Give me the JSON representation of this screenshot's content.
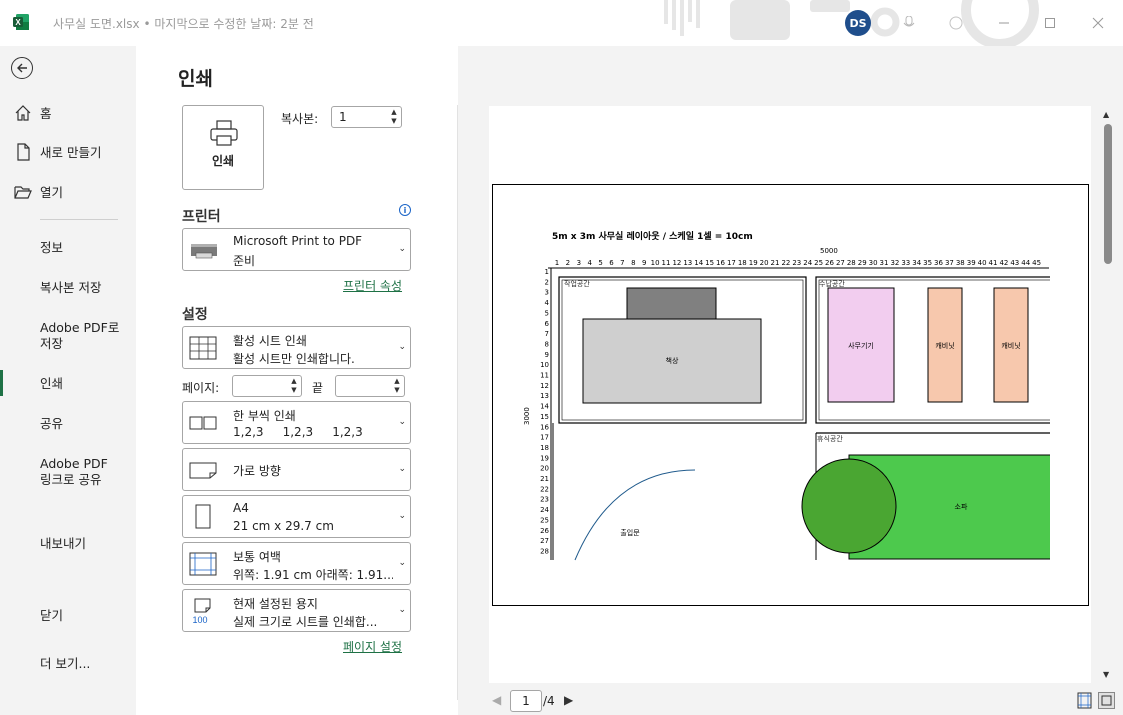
{
  "titlebar": {
    "file_name": "사무실 도면.xlsx",
    "separator": "•",
    "last_modified": "마지막으로 수정한 날짜: 2분 전",
    "user_initials": "DS"
  },
  "nav": {
    "back_label": "",
    "items": [
      {
        "label": "홈"
      },
      {
        "label": "새로 만들기"
      },
      {
        "label": "열기"
      },
      {
        "label": "정보"
      },
      {
        "label": "복사본 저장"
      },
      {
        "label": "Adobe PDF로 저장"
      },
      {
        "label": "인쇄"
      },
      {
        "label": "공유"
      },
      {
        "label": "Adobe PDF 링크로 공유"
      },
      {
        "label": "내보내기"
      },
      {
        "label": "닫기"
      },
      {
        "label": "더 보기..."
      }
    ]
  },
  "print": {
    "title": "인쇄",
    "print_button": "인쇄",
    "copies_label": "복사본:",
    "copies_value": "1",
    "printer_header": "프린터",
    "printer_name": "Microsoft Print to PDF",
    "printer_status": "준비",
    "printer_properties": "프린터 속성",
    "settings_header": "설정",
    "scope_title": "활성 시트 인쇄",
    "scope_desc": "활성 시트만 인쇄합니다.",
    "pages_label": "페이지:",
    "to_label": "끝",
    "collate_title": "한 부씩 인쇄",
    "collate_desc": "1,2,3     1,2,3     1,2,3",
    "orientation": "가로 방향",
    "paper_size": "A4",
    "paper_dims": "21 cm x 29.7 cm",
    "margins_title": "보통 여백",
    "margins_desc": "위쪽: 1.91 cm 아래쪽: 1.91...",
    "scaling_title": "현재 설정된 용지",
    "scaling_desc": "실제 크기로 시트를 인쇄합...",
    "scaling_badge": "100",
    "page_setup": "페이지 설정"
  },
  "preview": {
    "sheet_title": "5m x 3m 사무실 레이아웃 / 스케일 1셀 = 10cm",
    "top_dimension": "5000",
    "side_dimension": "3000",
    "zones": {
      "work": "작업공간",
      "storage": "수납공간",
      "rest": "휴식공간"
    },
    "labels": {
      "desk": "책상",
      "copier": "사무기기",
      "cabinet1": "캐비닛",
      "cabinet2": "캐비닛",
      "sofa": "소파",
      "door": "출입문"
    },
    "colors": {
      "copier": "#f2cdef",
      "cabinet": "#f7c8ad",
      "sofa": "#4dc94d",
      "table": "#4aa632",
      "desk": "#cfcfcf",
      "monitor": "#808080"
    },
    "current_page": "1",
    "total_pages": "/4"
  },
  "colors": {
    "accent": "#1e7145",
    "link_blue": "#1b64c7"
  }
}
